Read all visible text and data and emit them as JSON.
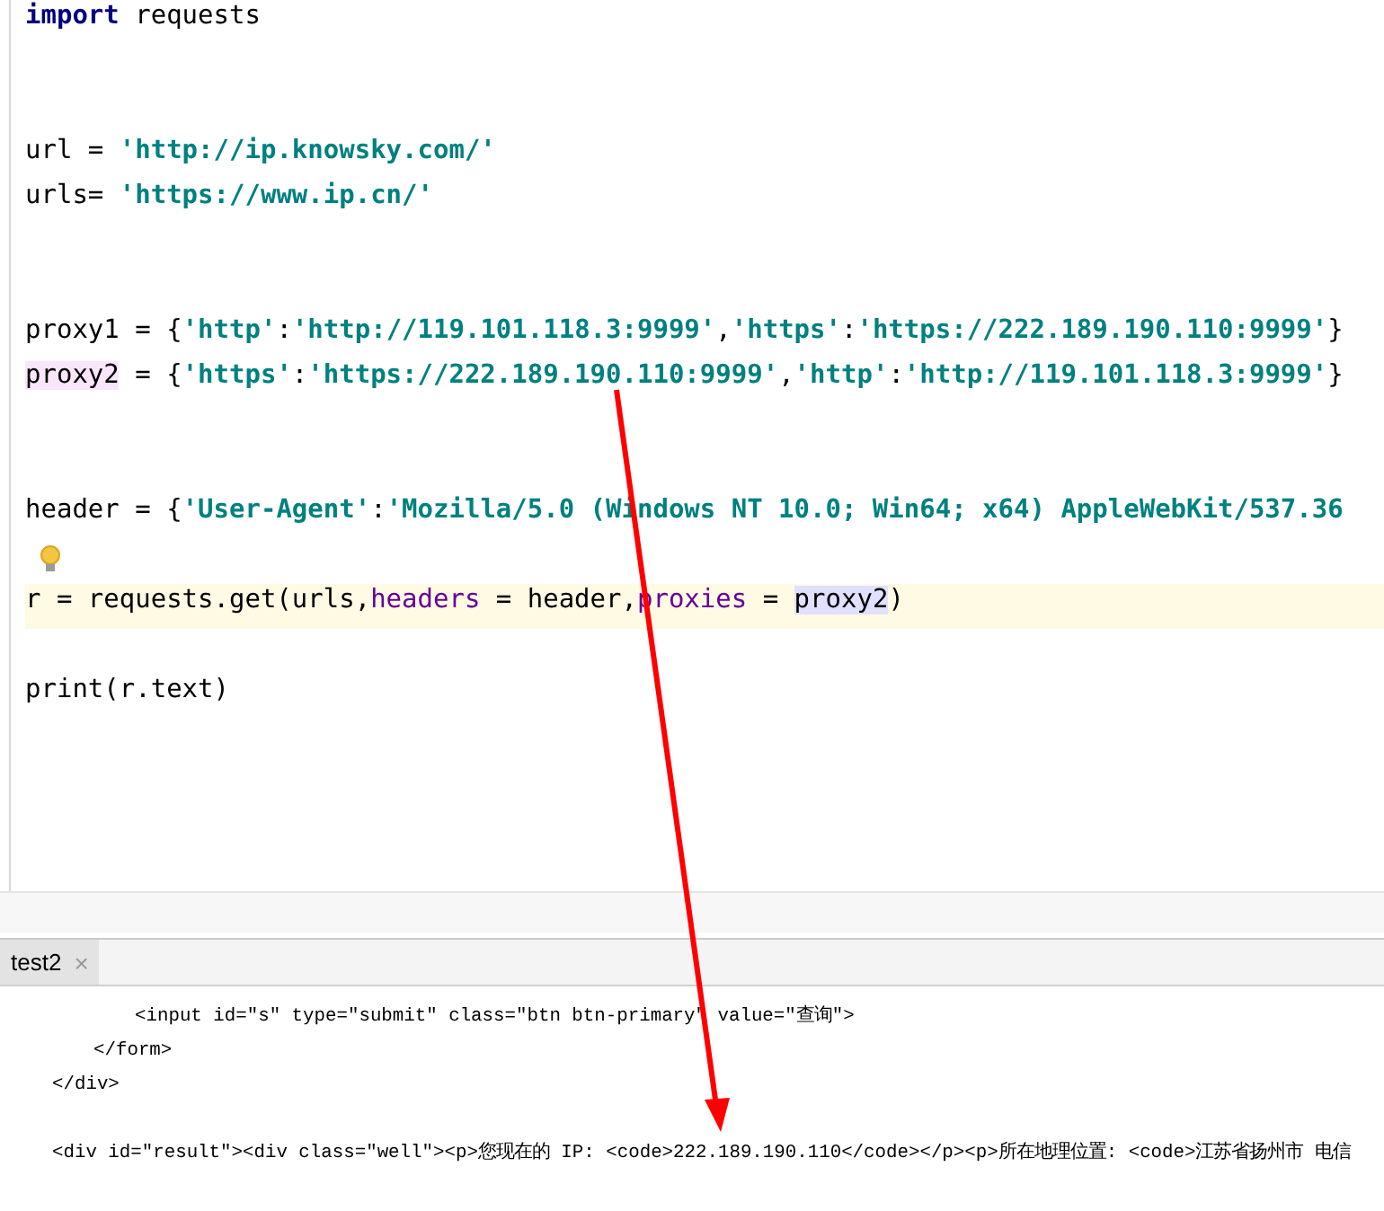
{
  "editor": {
    "lines": [
      {
        "kind": "code",
        "segments": [
          {
            "kind": "keyword",
            "text": "import"
          },
          {
            "kind": "plain",
            "text": " requests"
          }
        ]
      },
      {
        "kind": "blank"
      },
      {
        "kind": "blank"
      },
      {
        "kind": "code",
        "segments": [
          {
            "kind": "plain",
            "text": "url = "
          },
          {
            "kind": "string",
            "text": "'http://ip.knowsky.com/'"
          }
        ]
      },
      {
        "kind": "code",
        "segments": [
          {
            "kind": "plain",
            "text": "urls= "
          },
          {
            "kind": "string",
            "text": "'https://www.ip.cn/'"
          }
        ]
      },
      {
        "kind": "blank"
      },
      {
        "kind": "blank"
      },
      {
        "kind": "code",
        "segments": [
          {
            "kind": "plain",
            "text": "proxy1 = {"
          },
          {
            "kind": "string",
            "text": "'http'"
          },
          {
            "kind": "plain",
            "text": ":"
          },
          {
            "kind": "string",
            "text": "'http://119.101.118.3:9999'"
          },
          {
            "kind": "plain",
            "text": ","
          },
          {
            "kind": "string",
            "text": "'https'"
          },
          {
            "kind": "plain",
            "text": ":"
          },
          {
            "kind": "string",
            "text": "'https://222.189.190.110:9999'"
          },
          {
            "kind": "plain",
            "text": "}"
          }
        ]
      },
      {
        "kind": "code",
        "segments": [
          {
            "kind": "declaration",
            "text": "proxy2"
          },
          {
            "kind": "plain",
            "text": " = {"
          },
          {
            "kind": "string",
            "text": "'https'"
          },
          {
            "kind": "plain",
            "text": ":"
          },
          {
            "kind": "string",
            "text": "'https://222.189.190.110:9999'"
          },
          {
            "kind": "plain",
            "text": ","
          },
          {
            "kind": "string",
            "text": "'http'"
          },
          {
            "kind": "plain",
            "text": ":"
          },
          {
            "kind": "string",
            "text": "'http://119.101.118.3:9999'"
          },
          {
            "kind": "plain",
            "text": "}"
          }
        ]
      },
      {
        "kind": "blank"
      },
      {
        "kind": "blank"
      },
      {
        "kind": "code",
        "segments": [
          {
            "kind": "plain",
            "text": "header = {"
          },
          {
            "kind": "string",
            "text": "'User-Agent'"
          },
          {
            "kind": "plain",
            "text": ":"
          },
          {
            "kind": "string",
            "text": "'Mozilla/5.0 (Windows NT 10.0; Win64; x64) AppleWebKit/537.36"
          }
        ]
      },
      {
        "kind": "blank",
        "bulb": true
      },
      {
        "kind": "code",
        "current": true,
        "segments": [
          {
            "kind": "plain",
            "text": "r = requests.get(urls,"
          },
          {
            "kind": "param",
            "text": "headers"
          },
          {
            "kind": "plain",
            "text": " = header,"
          },
          {
            "kind": "param",
            "text": "proxies"
          },
          {
            "kind": "plain",
            "text": " = "
          },
          {
            "kind": "usage",
            "text": "proxy2"
          },
          {
            "kind": "plain",
            "text": ")"
          }
        ]
      },
      {
        "kind": "blank"
      },
      {
        "kind": "code",
        "segments": [
          {
            "kind": "plain",
            "text": "print(r.text)"
          }
        ]
      }
    ]
  },
  "run_panel": {
    "tabs": [
      {
        "label": "test2",
        "selected": true,
        "close": "×"
      }
    ],
    "lines": [
      {
        "children": [
          {
            "children": [
              {
                "text": "<input id=\"s\" type=\"submit\" class=\"btn btn-primary\" value=\"查询\">"
              }
            ]
          },
          {
            "text": "</form>"
          }
        ]
      },
      {
        "text": "</div>"
      },
      {
        "kind": "blank"
      },
      {
        "text": "<div id=\"result\"><div class=\"well\"><p>您现在的 IP: <code>222.189.190.110</code></p><p>所在地理位置: <code>江苏省扬州市 电信"
      }
    ]
  },
  "annotation_arrow": true
}
